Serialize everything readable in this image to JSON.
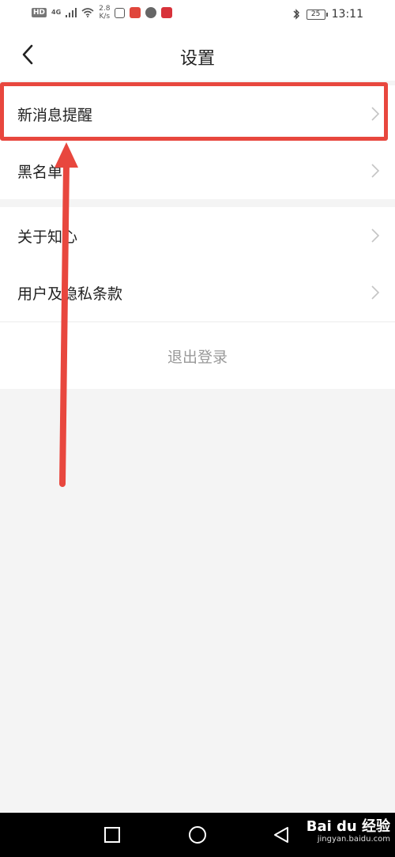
{
  "status_bar": {
    "hd": "HD",
    "network": "4G",
    "speed_value": "2.8",
    "speed_unit": "K/s",
    "battery": "25",
    "time": "13:11"
  },
  "header": {
    "title": "设置"
  },
  "groups": [
    {
      "items": [
        {
          "label": "新消息提醒"
        },
        {
          "label": "黑名单"
        }
      ]
    },
    {
      "items": [
        {
          "label": "关于知心"
        },
        {
          "label": "用户及隐私条款"
        }
      ]
    }
  ],
  "logout_label": "退出登录",
  "watermark": {
    "logo": "Bai du 经验",
    "url": "jingyan.baidu.com"
  },
  "colors": {
    "annotation": "#e8473e",
    "background": "#f4f4f4",
    "card": "#ffffff",
    "logout_text": "#999999"
  }
}
